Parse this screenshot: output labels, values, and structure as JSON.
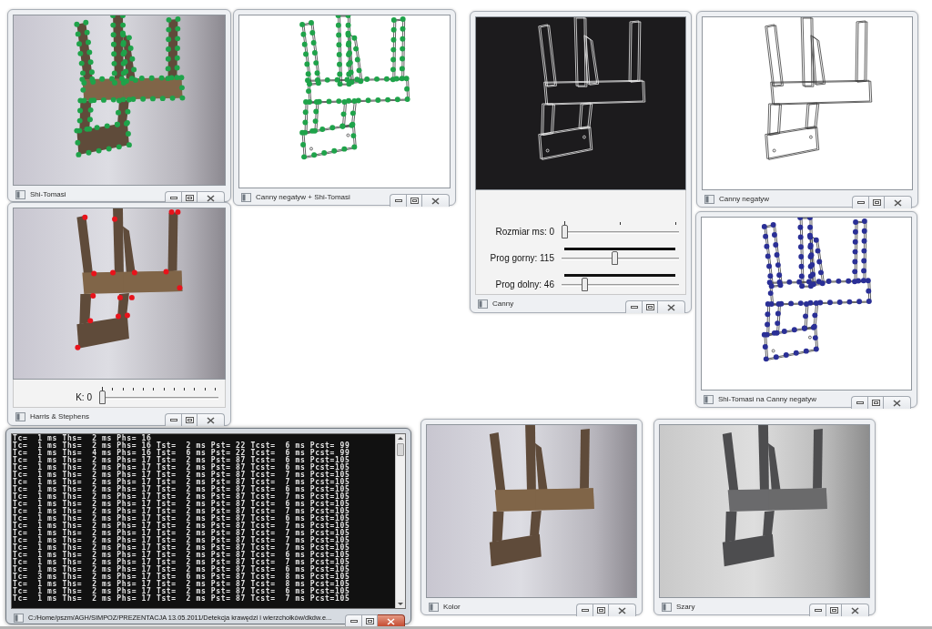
{
  "windows": [
    {
      "kind": "photo",
      "title": "Shi-Tomasi",
      "active": false,
      "markers": {
        "kind": "dense",
        "color": "#1fa34a"
      }
    },
    {
      "kind": "edges_light",
      "title": "Canny negatyw + Shi-Tomasi",
      "active": false,
      "markers": {
        "kind": "dense",
        "color": "#1fa34a"
      }
    },
    {
      "kind": "edges_dark",
      "title": "Canny",
      "active": false,
      "trackbars": [
        {
          "label": "Rozmiar ms: 0",
          "level": 0,
          "kind": "few"
        },
        {
          "label": "Prog gorny: 115",
          "level": 0.45,
          "kind": "dense"
        },
        {
          "label": "Prog dolny: 46",
          "level": 0.18,
          "kind": "dense"
        }
      ]
    },
    {
      "kind": "edges_light",
      "title": "Canny negatyw",
      "active": false
    },
    {
      "kind": "photo",
      "title": "Harris & Stephens",
      "active": false,
      "markers": {
        "kind": "corners",
        "color": "#e8131b"
      },
      "trackbars": [
        {
          "label": "K: 0",
          "level": 0,
          "kind": "many"
        }
      ]
    },
    {
      "kind": "edges_light",
      "title": "Shi-Tomasi na Canny negatyw",
      "active": false,
      "markers": {
        "kind": "dense",
        "color": "#2a2f96"
      }
    },
    {
      "kind": "console",
      "title": "C:/Home/pszm/AGH/SIMPOZ/PREZENTACJA 13.05.2011/Detekcja krawędzi i wierzchołków/dkdw.e...",
      "active": true,
      "lines": [
        "Tc=  1 ms Ths=  2 ms Phs= 16",
        "Tc=  1 ms Ths=  2 ms Phs= 16 Tst=  2 ms Pst= 22 Tcst=  6 ms Pcst= 99",
        "Tc=  1 ms Ths=  4 ms Phs= 16 Tst=  6 ms Pst= 22 Tcst=  6 ms Pcst= 99",
        "Tc=  1 ms Ths=  2 ms Phs= 17 Tst=  2 ms Pst= 87 Tcst=  6 ms Pcst=105",
        "Tc=  1 ms Ths=  2 ms Phs= 17 Tst=  2 ms Pst= 87 Tcst=  6 ms Pcst=105",
        "Tc=  1 ms Ths=  2 ms Phs= 17 Tst=  2 ms Pst= 87 Tcst=  7 ms Pcst=105",
        "Tc=  1 ms Ths=  2 ms Phs= 17 Tst=  2 ms Pst= 87 Tcst=  7 ms Pcst=105",
        "Tc=  1 ms Ths=  2 ms Phs= 17 Tst=  2 ms Pst= 87 Tcst=  6 ms Pcst=105",
        "Tc=  1 ms Ths=  2 ms Phs= 17 Tst=  2 ms Pst= 87 Tcst=  7 ms Pcst=105",
        "Tc=  1 ms Ths=  2 ms Phs= 17 Tst=  2 ms Pst= 87 Tcst=  6 ms Pcst=105",
        "Tc=  1 ms Ths=  2 ms Phs= 17 Tst=  2 ms Pst= 87 Tcst=  7 ms Pcst=105",
        "Tc=  1 ms Ths=  2 ms Phs= 17 Tst=  2 ms Pst= 87 Tcst=  6 ms Pcst=105",
        "Tc=  1 ms Ths=  2 ms Phs= 17 Tst=  2 ms Pst= 87 Tcst=  7 ms Pcst=105",
        "Tc=  1 ms Ths=  2 ms Phs= 17 Tst=  2 ms Pst= 87 Tcst=  7 ms Pcst=105",
        "Tc=  1 ms Ths=  2 ms Phs= 17 Tst=  2 ms Pst= 87 Tcst=  7 ms Pcst=105",
        "Tc=  1 ms Ths=  2 ms Phs= 17 Tst=  2 ms Pst= 87 Tcst=  7 ms Pcst=105",
        "Tc=  1 ms Ths=  2 ms Phs= 17 Tst=  2 ms Pst= 87 Tcst=  6 ms Pcst=105",
        "Tc=  1 ms Ths=  2 ms Phs= 17 Tst=  2 ms Pst= 87 Tcst=  7 ms Pcst=105",
        "Tc=  1 ms Ths=  2 ms Phs= 17 Tst=  2 ms Pst= 87 Tcst=  6 ms Pcst=105",
        "Tc=  3 ms Ths=  2 ms Phs= 17 Tst=  6 ms Pst= 87 Tcst=  8 ms Pcst=105",
        "Tc=  1 ms Ths=  2 ms Phs= 17 Tst=  2 ms Pst= 87 Tcst=  8 ms Pcst=105",
        "Tc=  1 ms Ths=  2 ms Phs= 17 Tst=  2 ms Pst= 87 Tcst=  6 ms Pcst=105",
        "Tc=  1 ms Ths=  2 ms Phs= 17 Tst=  2 ms Pst= 87 Tcst=  7 ms Pcst=105"
      ]
    },
    {
      "kind": "photo",
      "title": "Kolor",
      "active": false
    },
    {
      "kind": "photo_gray",
      "title": "Szary",
      "active": false
    }
  ]
}
